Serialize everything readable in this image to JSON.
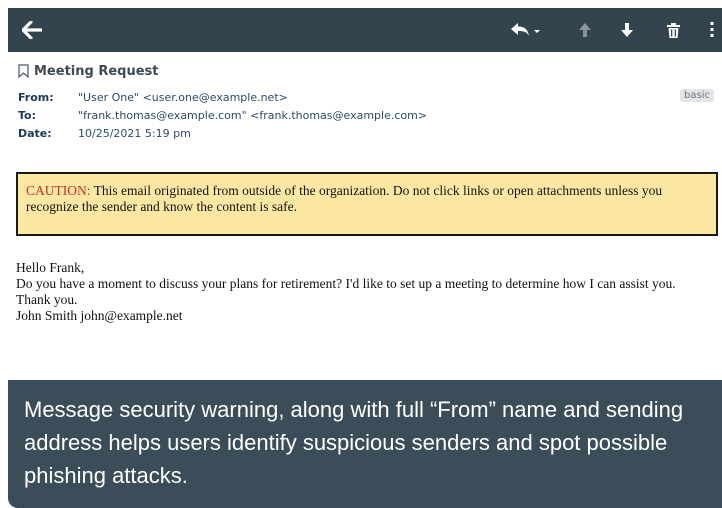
{
  "toolbar": {
    "icons": [
      "back-arrow-icon",
      "reply-icon",
      "up-arrow-icon",
      "down-arrow-icon",
      "trash-icon",
      "more-icon"
    ]
  },
  "message": {
    "subject": "Meeting Request",
    "badge": "basic",
    "headers": [
      {
        "label": "From:",
        "value": "\"User One\" <user.one@example.net>"
      },
      {
        "label": "To:",
        "value": "\"frank.thomas@example.com\" <frank.thomas@example.com>"
      },
      {
        "label": "Date:",
        "value": "10/25/2021 5:19 pm"
      }
    ],
    "caution_lead": "CAUTION:",
    "caution_text": " This email originated from outside of the organization. Do not click links or open attachments unless you recognize the sender and know the content is safe.",
    "body_lines": [
      "Hello Frank,",
      "Do you have a moment to discuss your plans for retirement? I'd like to set up a meeting to determine how I can assist you.",
      "Thank you.",
      "John Smith john@example.net"
    ]
  },
  "caption": "Message security warning, along with full “From” name and sending address helps users identify suspicious senders and spot possible phishing attacks.",
  "colors": {
    "toolbar": "#33444f",
    "caution_bg": "#fde8a3",
    "caution_lead": "#c0302a",
    "caption_bg": "#3b4d59"
  }
}
